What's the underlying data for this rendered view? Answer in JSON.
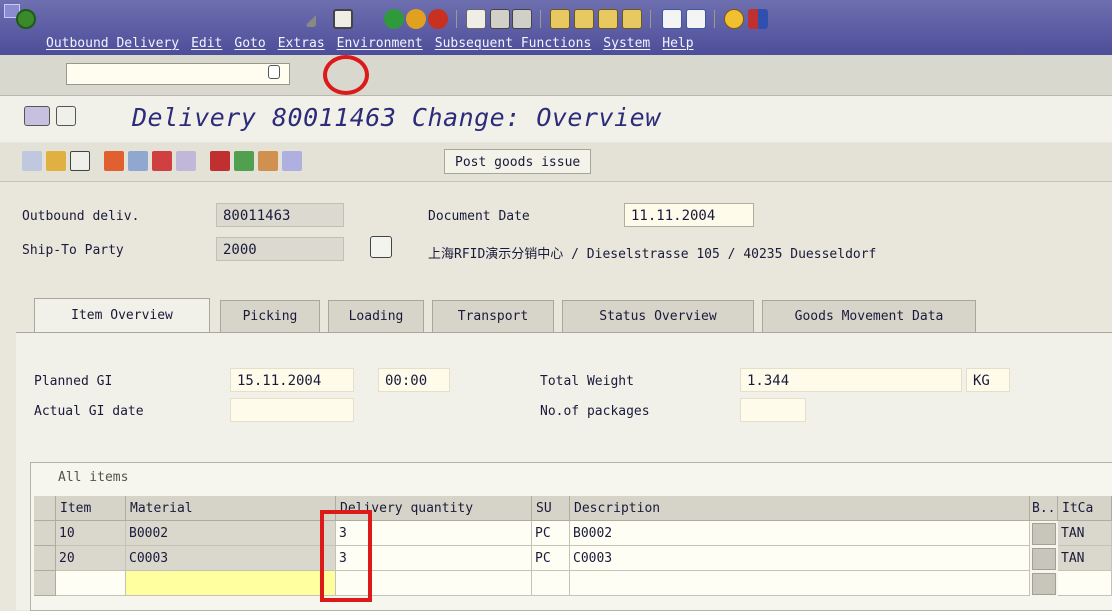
{
  "menubar": [
    "Outbound Delivery",
    "Edit",
    "Goto",
    "Extras",
    "Environment",
    "Subsequent Functions",
    "System",
    "Help"
  ],
  "title": "Delivery 80011463 Change: Overview",
  "app_toolbar": {
    "post_goods_issue": "Post goods issue"
  },
  "header": {
    "outbound_label": "Outbound deliv.",
    "outbound_value": "80011463",
    "shipto_label": "Ship-To Party",
    "shipto_value": "2000",
    "docdate_label": "Document Date",
    "docdate_value": "11.11.2004",
    "address": "上海RFID演示分销中心 / Dieselstrasse 105 / 40235 Duesseldorf"
  },
  "tabs": [
    "Item Overview",
    "Picking",
    "Loading",
    "Transport",
    "Status Overview",
    "Goods Movement Data"
  ],
  "item_overview": {
    "planned_gi_label": "Planned GI",
    "planned_gi_date": "15.11.2004",
    "planned_gi_time": "00:00",
    "actual_gi_label": "Actual GI date",
    "total_weight_label": "Total Weight",
    "total_weight_value": "1.344",
    "weight_unit": "KG",
    "packages_label": "No.of packages"
  },
  "table": {
    "caption": "All items",
    "columns": [
      "Item",
      "Material",
      "Delivery quantity",
      "SU",
      "Description",
      "B..",
      "ItCa"
    ],
    "rows": [
      {
        "item": "10",
        "material": "B0002",
        "qty": "3",
        "su": "PC",
        "description": "B0002",
        "itca": "TAN"
      },
      {
        "item": "20",
        "material": "C0003",
        "qty": "3",
        "su": "PC",
        "description": "C0003",
        "itca": "TAN"
      }
    ]
  },
  "colors": {
    "title_bar": "#5a5ba4",
    "title_text": "#2c2c7a",
    "annotation": "#dd1a1a",
    "input_yellow": "#ffffa0"
  },
  "icons": [
    "enter-icon",
    "save-icon",
    "back-icon",
    "exit-icon",
    "cancel-icon",
    "print-icon",
    "find-icon",
    "find-next-icon",
    "first-page-icon",
    "prev-page-icon",
    "next-page-icon",
    "last-page-icon",
    "new-session-icon",
    "shortcut-icon",
    "help-icon",
    "customize-icon"
  ]
}
